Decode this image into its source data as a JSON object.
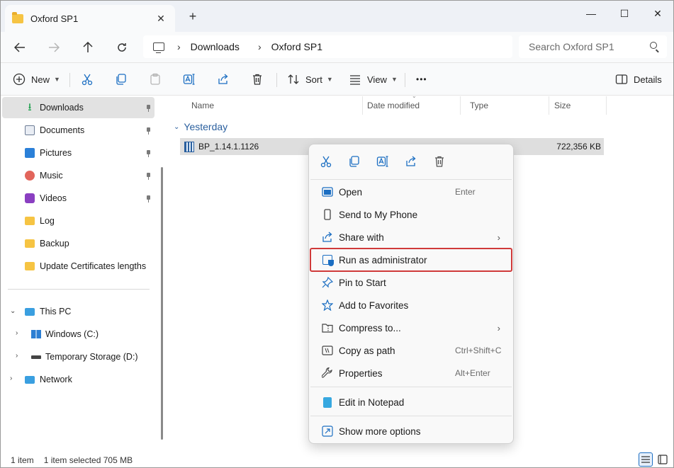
{
  "window": {
    "tab_title": "Oxford SP1",
    "tab_close": "✕",
    "new_tab": "+",
    "minimize": "—",
    "maximize": "☐",
    "close": "✕"
  },
  "address": {
    "crumbs": [
      "Downloads",
      "Oxford SP1"
    ],
    "separator": "›",
    "search_placeholder": "Search Oxford SP1"
  },
  "toolbar": {
    "new_label": "New",
    "sort_label": "Sort",
    "view_label": "View",
    "more_label": "•••",
    "details_label": "Details"
  },
  "sidebar": {
    "quick_access": [
      {
        "label": "Downloads",
        "icon": "download-icon",
        "pinned": true,
        "selected": true
      },
      {
        "label": "Documents",
        "icon": "documents-icon",
        "pinned": true
      },
      {
        "label": "Pictures",
        "icon": "pictures-icon",
        "pinned": true
      },
      {
        "label": "Music",
        "icon": "music-icon",
        "pinned": true
      },
      {
        "label": "Videos",
        "icon": "videos-icon",
        "pinned": true
      },
      {
        "label": "Log",
        "icon": "folder-icon"
      },
      {
        "label": "Backup",
        "icon": "folder-icon"
      },
      {
        "label": "Update Certificates lengths",
        "icon": "folder-icon"
      }
    ],
    "this_pc": "This PC",
    "drive_c": "Windows (C:)",
    "drive_d": "Temporary Storage (D:)",
    "network": "Network"
  },
  "columns": {
    "name": "Name",
    "date_modified": "Date modified",
    "type": "Type",
    "size": "Size"
  },
  "content": {
    "group_label": "Yesterday",
    "file": {
      "name": "BP_1.14.1.1126",
      "size": "722,356 KB"
    }
  },
  "status": {
    "item_count": "1 item",
    "selection": "1 item selected  705 MB"
  },
  "context_menu": {
    "quick_actions": [
      "cut-icon",
      "copy-icon",
      "rename-icon",
      "share-icon",
      "delete-icon"
    ],
    "items": {
      "open": {
        "label": "Open",
        "shortcut": "Enter"
      },
      "send_to_phone": {
        "label": "Send to My Phone"
      },
      "share_with": {
        "label": "Share with"
      },
      "run_as_admin": {
        "label": "Run as administrator"
      },
      "pin_to_start": {
        "label": "Pin to Start"
      },
      "add_to_favorites": {
        "label": "Add to Favorites"
      },
      "compress_to": {
        "label": "Compress to..."
      },
      "copy_as_path": {
        "label": "Copy as path",
        "shortcut": "Ctrl+Shift+C"
      },
      "properties": {
        "label": "Properties",
        "shortcut": "Alt+Enter"
      },
      "edit_in_notepad": {
        "label": "Edit in Notepad"
      },
      "show_more_options": {
        "label": "Show more options"
      }
    },
    "submenu_arrow": "›"
  },
  "colors": {
    "accent": "#1b6ec2",
    "highlight_outline": "#d03a3a",
    "selection": "#dedede"
  }
}
